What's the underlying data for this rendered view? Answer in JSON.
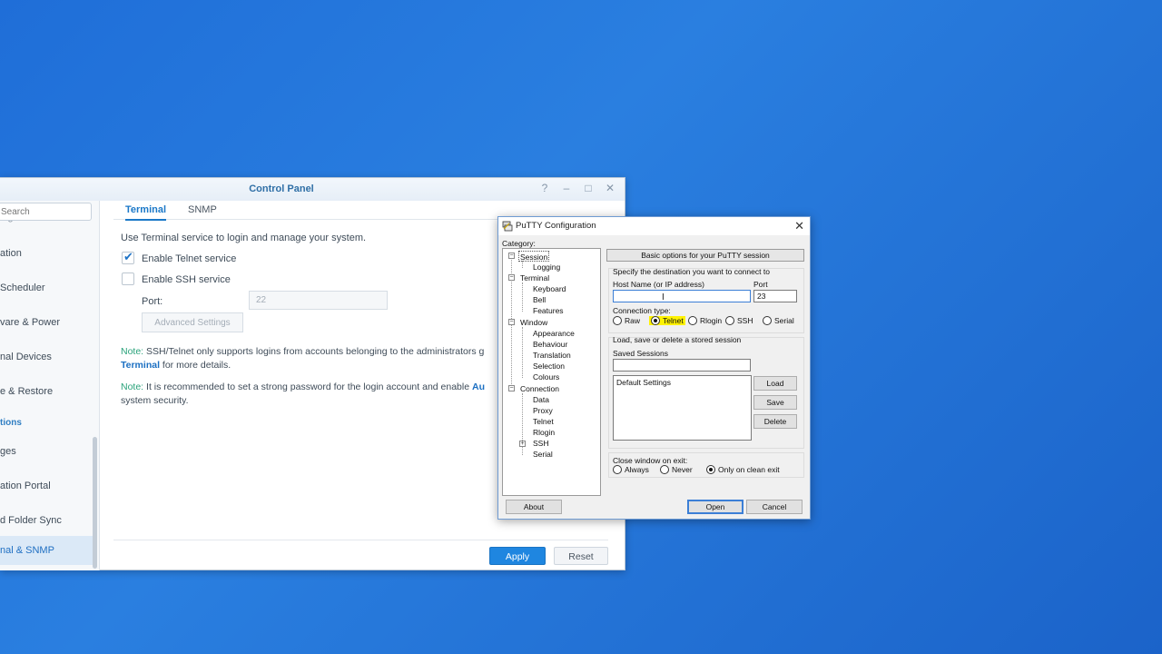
{
  "control_panel": {
    "title": "Control Panel",
    "window_controls": [
      "?",
      "–",
      "□",
      "✕"
    ],
    "search_placeholder": "Search",
    "sidebar": {
      "items": [
        {
          "label": "ing Service"
        },
        {
          "label": "ation"
        },
        {
          "label": "Scheduler"
        },
        {
          "label": "vare & Power"
        },
        {
          "label": "nal Devices"
        },
        {
          "label": "e & Restore"
        },
        {
          "label": "tions"
        },
        {
          "label": "ges"
        },
        {
          "label": "ation Portal"
        },
        {
          "label": "d Folder Sync"
        },
        {
          "label": "nal & SNMP"
        }
      ]
    },
    "tabs": [
      "Terminal",
      "SNMP"
    ],
    "description": "Use Terminal service to login and manage your system.",
    "telnet_label": "Enable Telnet service",
    "ssh_label": "Enable SSH service",
    "port_label": "Port:",
    "port_value": "22",
    "advanced_label": "Advanced Settings",
    "note1_prefix": "Note:",
    "note1_text": " SSH/Telnet only supports logins from accounts belonging to the administrators g",
    "note1_link": "Terminal",
    "note1_tail": " for more details.",
    "note2_prefix": "Note:",
    "note2_text": " It is recommended to set a strong password for the login account and enable ",
    "note2_link": "Au",
    "note2_line2": "system security.",
    "apply_label": "Apply",
    "reset_label": "Reset"
  },
  "putty": {
    "title": "PuTTY Configuration",
    "close": "✕",
    "category_label": "Category:",
    "tree": {
      "session": "Session",
      "logging": "Logging",
      "terminal": "Terminal",
      "keyboard": "Keyboard",
      "bell": "Bell",
      "features": "Features",
      "window": "Window",
      "appearance": "Appearance",
      "behaviour": "Behaviour",
      "translation": "Translation",
      "selection": "Selection",
      "colours": "Colours",
      "connection": "Connection",
      "data": "Data",
      "proxy": "Proxy",
      "telnet": "Telnet",
      "rlogin": "Rlogin",
      "ssh": "SSH",
      "serial": "Serial"
    },
    "header": "Basic options for your PuTTY session",
    "destination_label": "Specify the destination you want to connect to",
    "host_label": "Host Name (or IP address)",
    "host_value": "",
    "port_label": "Port",
    "port_value": "23",
    "conn_type_label": "Connection type:",
    "conn_types": {
      "raw": "Raw",
      "telnet": "Telnet",
      "rlogin": "Rlogin",
      "ssh": "SSH",
      "serial": "Serial"
    },
    "selected_conn_type": "Telnet",
    "sessions_group_label": "Load, save or delete a stored session",
    "saved_sessions_label": "Saved Sessions",
    "saved_sessions_value": "",
    "sessions_list": [
      "Default Settings"
    ],
    "load_label": "Load",
    "save_label": "Save",
    "delete_label": "Delete",
    "close_on_exit_label": "Close window on exit:",
    "exit_options": {
      "always": "Always",
      "never": "Never",
      "clean": "Only on clean exit"
    },
    "selected_exit_option": "Only on clean exit",
    "about_label": "About",
    "open_label": "Open",
    "cancel_label": "Cancel",
    "highlight_color": "#fff200"
  }
}
